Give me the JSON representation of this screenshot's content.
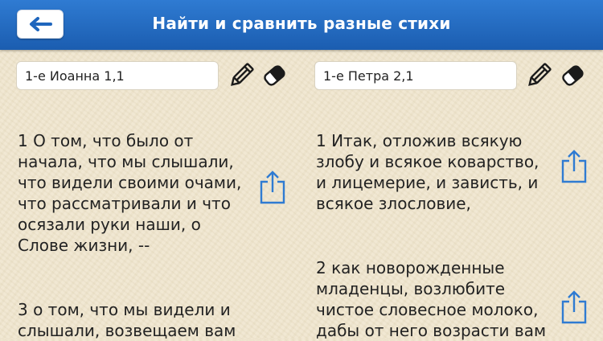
{
  "header": {
    "back_icon": "arrow-left-icon",
    "title": "Найти и сравнить разные стихи",
    "color": "#1f66bd"
  },
  "left_column": {
    "reference_value": "1-е Иоанна 1,1",
    "edit_icon": "pencil-icon",
    "clear_icon": "eraser-icon",
    "verses": [
      {
        "text": "1 О том, что было от\nначала, что мы слышали,\nчто видели своими очами,\nчто рассматривали и что\nосязали руки наши, о\nСлове жизни, --",
        "share_icon": "share-icon"
      },
      {
        "text": "3 о том, что мы видели и\nслышали, возвещаем вам"
      }
    ]
  },
  "right_column": {
    "reference_value": "1-е Петра 2,1",
    "edit_icon": "pencil-icon",
    "clear_icon": "eraser-icon",
    "verses": [
      {
        "text": "1 Итак, отложив всякую\nзлобу и всякое коварство,\nи лицемерие, и зависть, и\nвсякое злословие,",
        "share_icon": "share-icon"
      },
      {
        "text": "2 как новорожденные\nмладенцы, возлюбите\nчистое словесное молоко,\nдабы от него возрасти вам",
        "share_icon": "share-icon"
      }
    ]
  },
  "colors": {
    "accent": "#2f7bd2",
    "background": "#efe6cf",
    "icon": "#1a1a1a"
  }
}
